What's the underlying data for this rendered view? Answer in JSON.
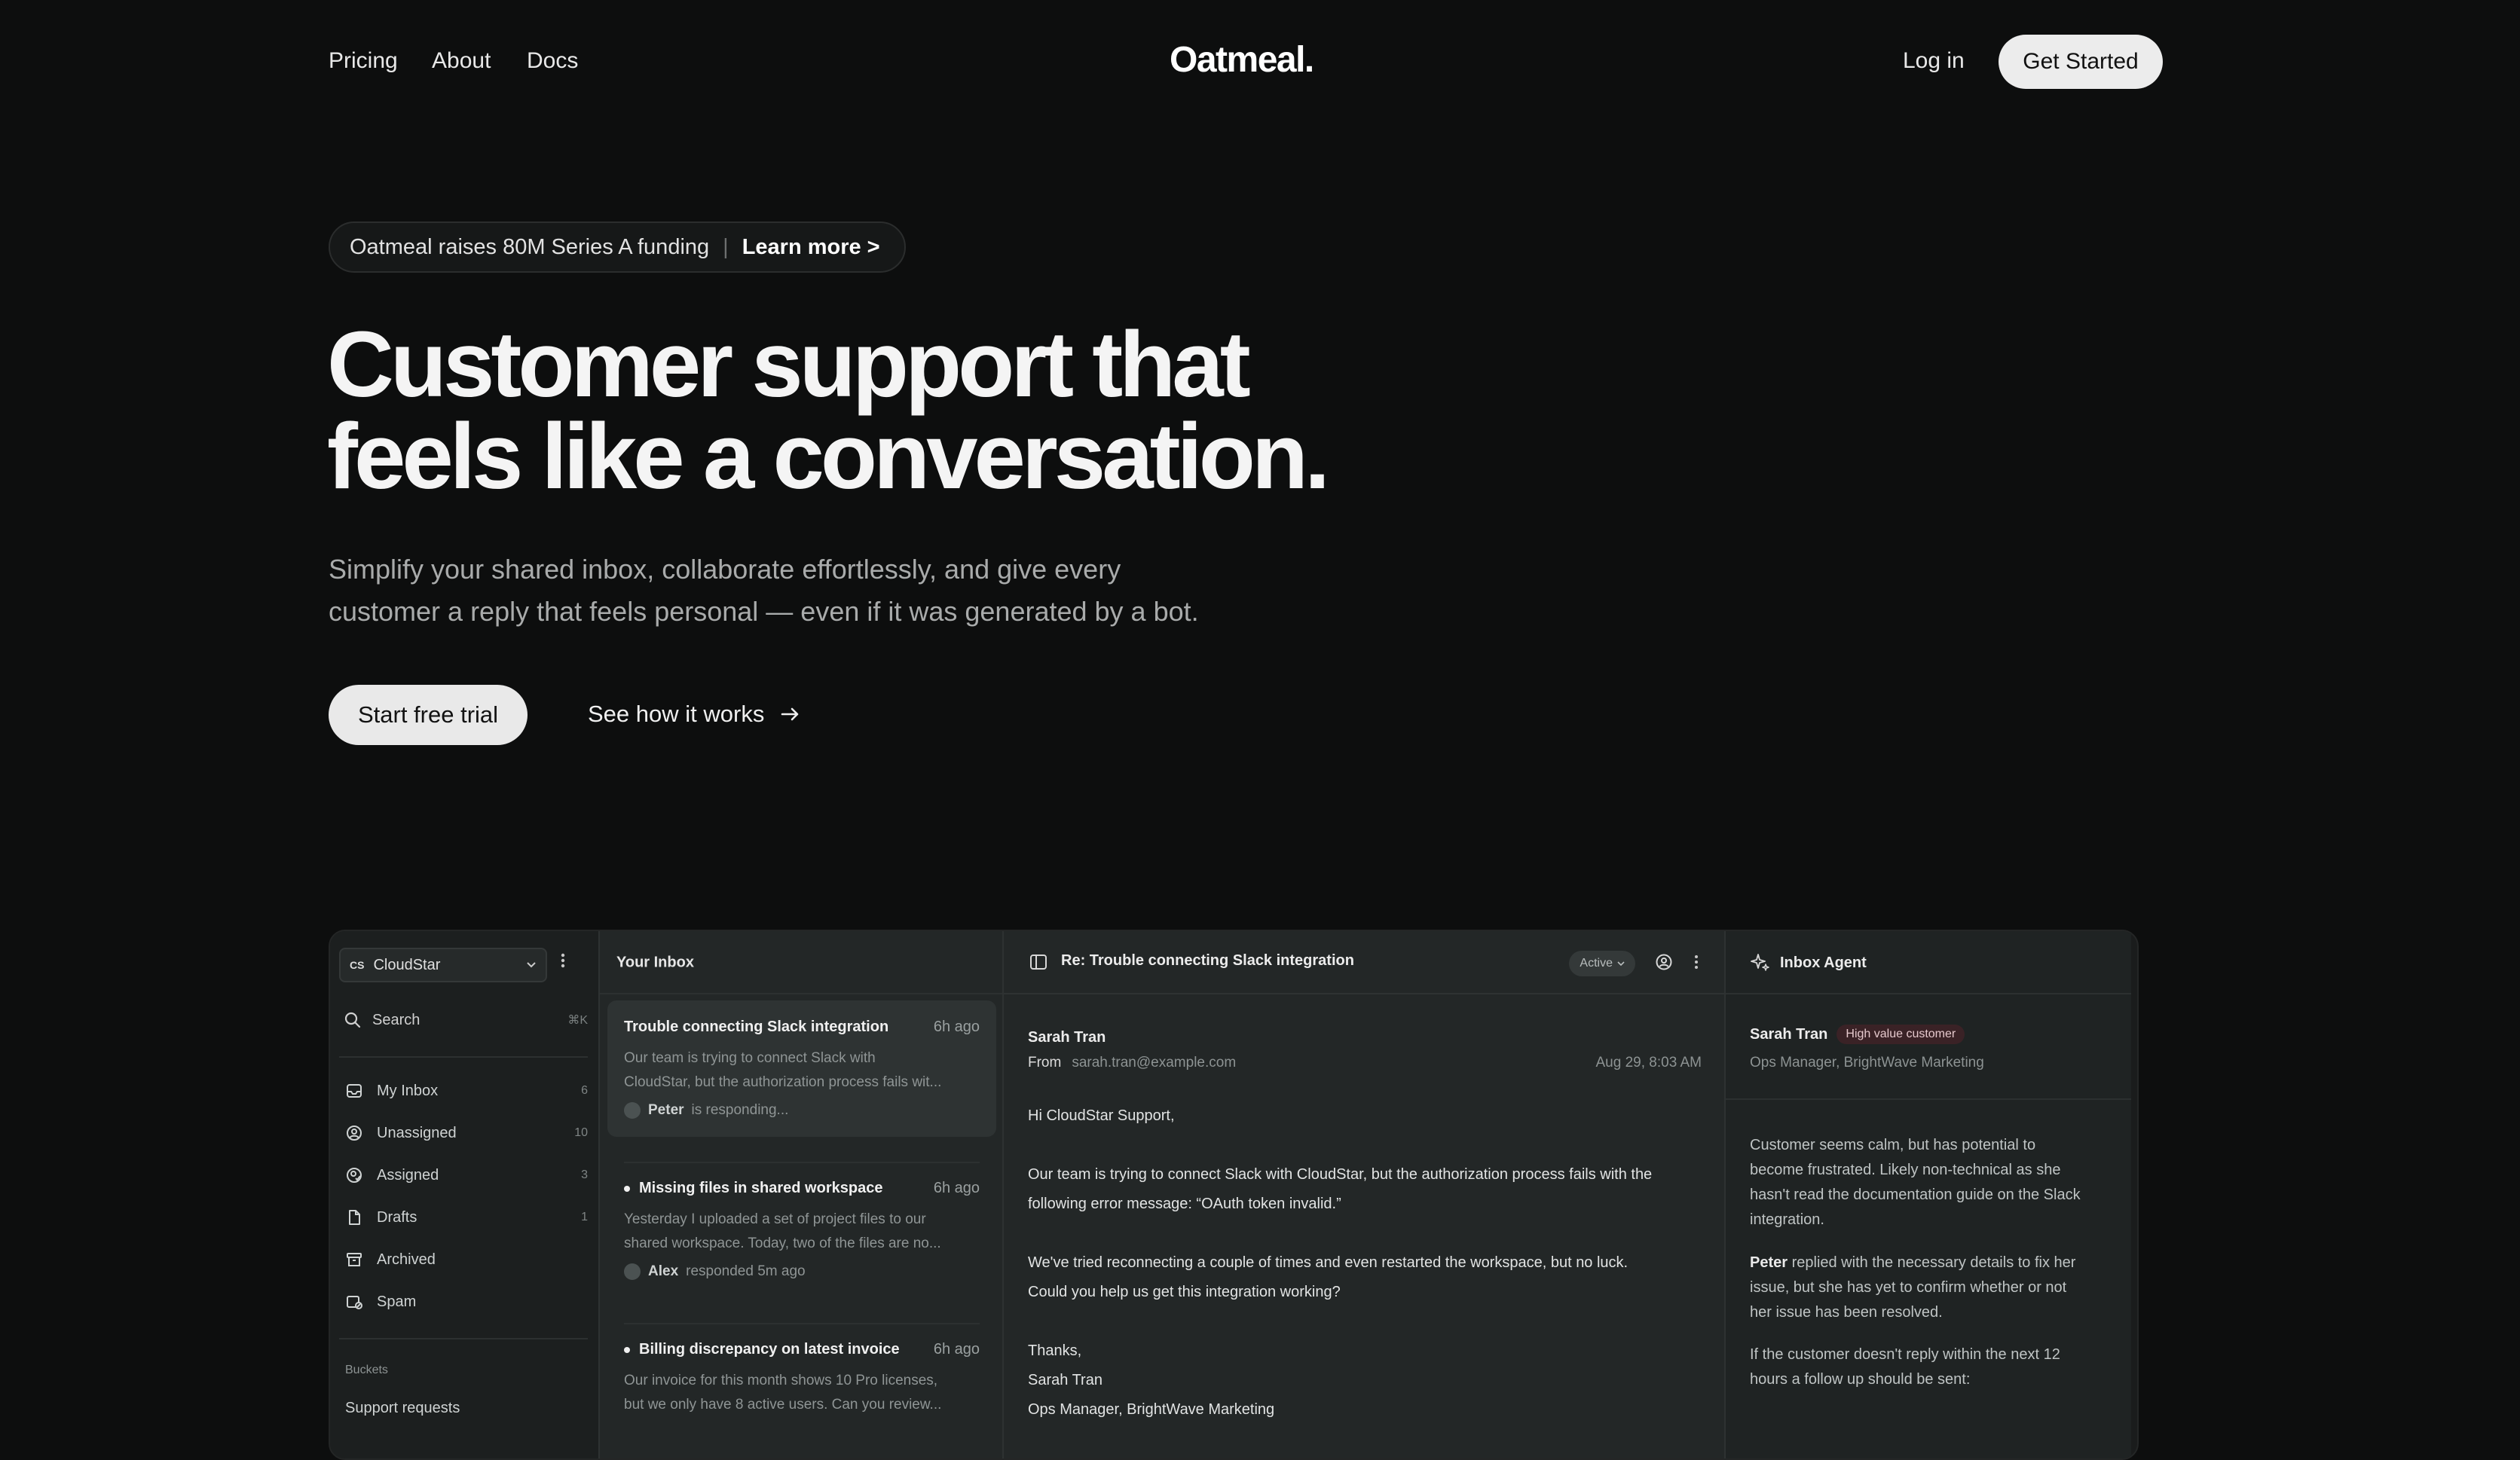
{
  "nav": {
    "links": [
      "Pricing",
      "About",
      "Docs"
    ],
    "logo": "Oatmeal.",
    "login": "Log in",
    "get_started": "Get Started"
  },
  "announcement": {
    "text": "Oatmeal raises 80M Series A funding",
    "separator": "|",
    "link": "Learn more >"
  },
  "hero": {
    "headline_line1": "Customer support that",
    "headline_line2": "feels like a conversation.",
    "subtitle_line1": "Simplify your shared inbox, collaborate effortlessly, and give every",
    "subtitle_line2": "customer a reply that feels personal — even if it was generated by a bot.",
    "primary_cta": "Start free trial",
    "secondary_cta": "See how it works",
    "secondary_cta_icon": "arrow-right-icon"
  },
  "app": {
    "sidebar": {
      "workspace_initials": "CS",
      "workspace_name": "CloudStar",
      "search_placeholder": "Search",
      "search_shortcut": "⌘K",
      "items": [
        {
          "label": "My Inbox",
          "count": "6",
          "icon": "inbox-icon"
        },
        {
          "label": "Unassigned",
          "count": "10",
          "icon": "user-circle-icon"
        },
        {
          "label": "Assigned",
          "count": "3",
          "icon": "user-check-icon"
        },
        {
          "label": "Drafts",
          "count": "1",
          "icon": "file-icon"
        },
        {
          "label": "Archived",
          "count": "",
          "icon": "archive-icon"
        },
        {
          "label": "Spam",
          "count": "",
          "icon": "spam-icon"
        }
      ],
      "buckets_label": "Buckets",
      "bucket_first": "Support requests"
    },
    "inbox": {
      "title": "Your Inbox",
      "messages": [
        {
          "subject": "Trouble connecting Slack integration",
          "time": "6h ago",
          "preview1": "Our team is trying to connect Slack with",
          "preview2": "CloudStar, but the authorization process fails wit...",
          "who": "Peter",
          "status": "is responding..."
        },
        {
          "subject": "Missing files in shared workspace",
          "time": "6h ago",
          "preview1": "Yesterday I uploaded a set of project files to our",
          "preview2": "shared workspace. Today, two of the files are no...",
          "who": "Alex",
          "status": "responded 5m ago"
        },
        {
          "subject": "Billing discrepancy on latest invoice",
          "time": "6h ago",
          "preview1": "Our invoice for this month shows 10 Pro licenses,",
          "preview2": "but we only have 8 active users. Can you review..."
        }
      ]
    },
    "thread": {
      "title": "Re: Trouble connecting Slack integration",
      "status": "Active",
      "sender": "Sarah Tran",
      "from_label": "From",
      "from_email": "sarah.tran@example.com",
      "date": "Aug 29, 8:03 AM",
      "greeting": "Hi CloudStar Support,",
      "p1_line1": "Our team is trying to connect Slack with CloudStar, but the authorization process fails with the",
      "p1_line2": "following error message: “OAuth token invalid.”",
      "p2_line1": "We've tried reconnecting a couple of times and even restarted the workspace, but no luck.",
      "p2_line2": "Could you help us get this integration working?",
      "signoff": "Thanks,",
      "sig_name": "Sarah Tran",
      "sig_title": "Ops Manager, BrightWave Marketing"
    },
    "agent": {
      "title": "Inbox Agent",
      "customer_name": "Sarah Tran",
      "customer_tag": "High value customer",
      "customer_role": "Ops Manager, BrightWave Marketing",
      "note1_l1": "Customer seems calm, but has potential to",
      "note1_l2": "become frustrated. Likely non-technical as she",
      "note1_l3": "hasn't read the documentation guide on the Slack",
      "note1_l4": "integration.",
      "note2_name": "Peter",
      "note2_l1": " replied with the necessary details to fix her",
      "note2_l2": "issue, but she has yet to confirm whether or not",
      "note2_l3": "her issue has been resolved.",
      "note3_l1": "If the customer doesn't reply within the next 12",
      "note3_l2": "hours a follow up should be sent:"
    }
  }
}
